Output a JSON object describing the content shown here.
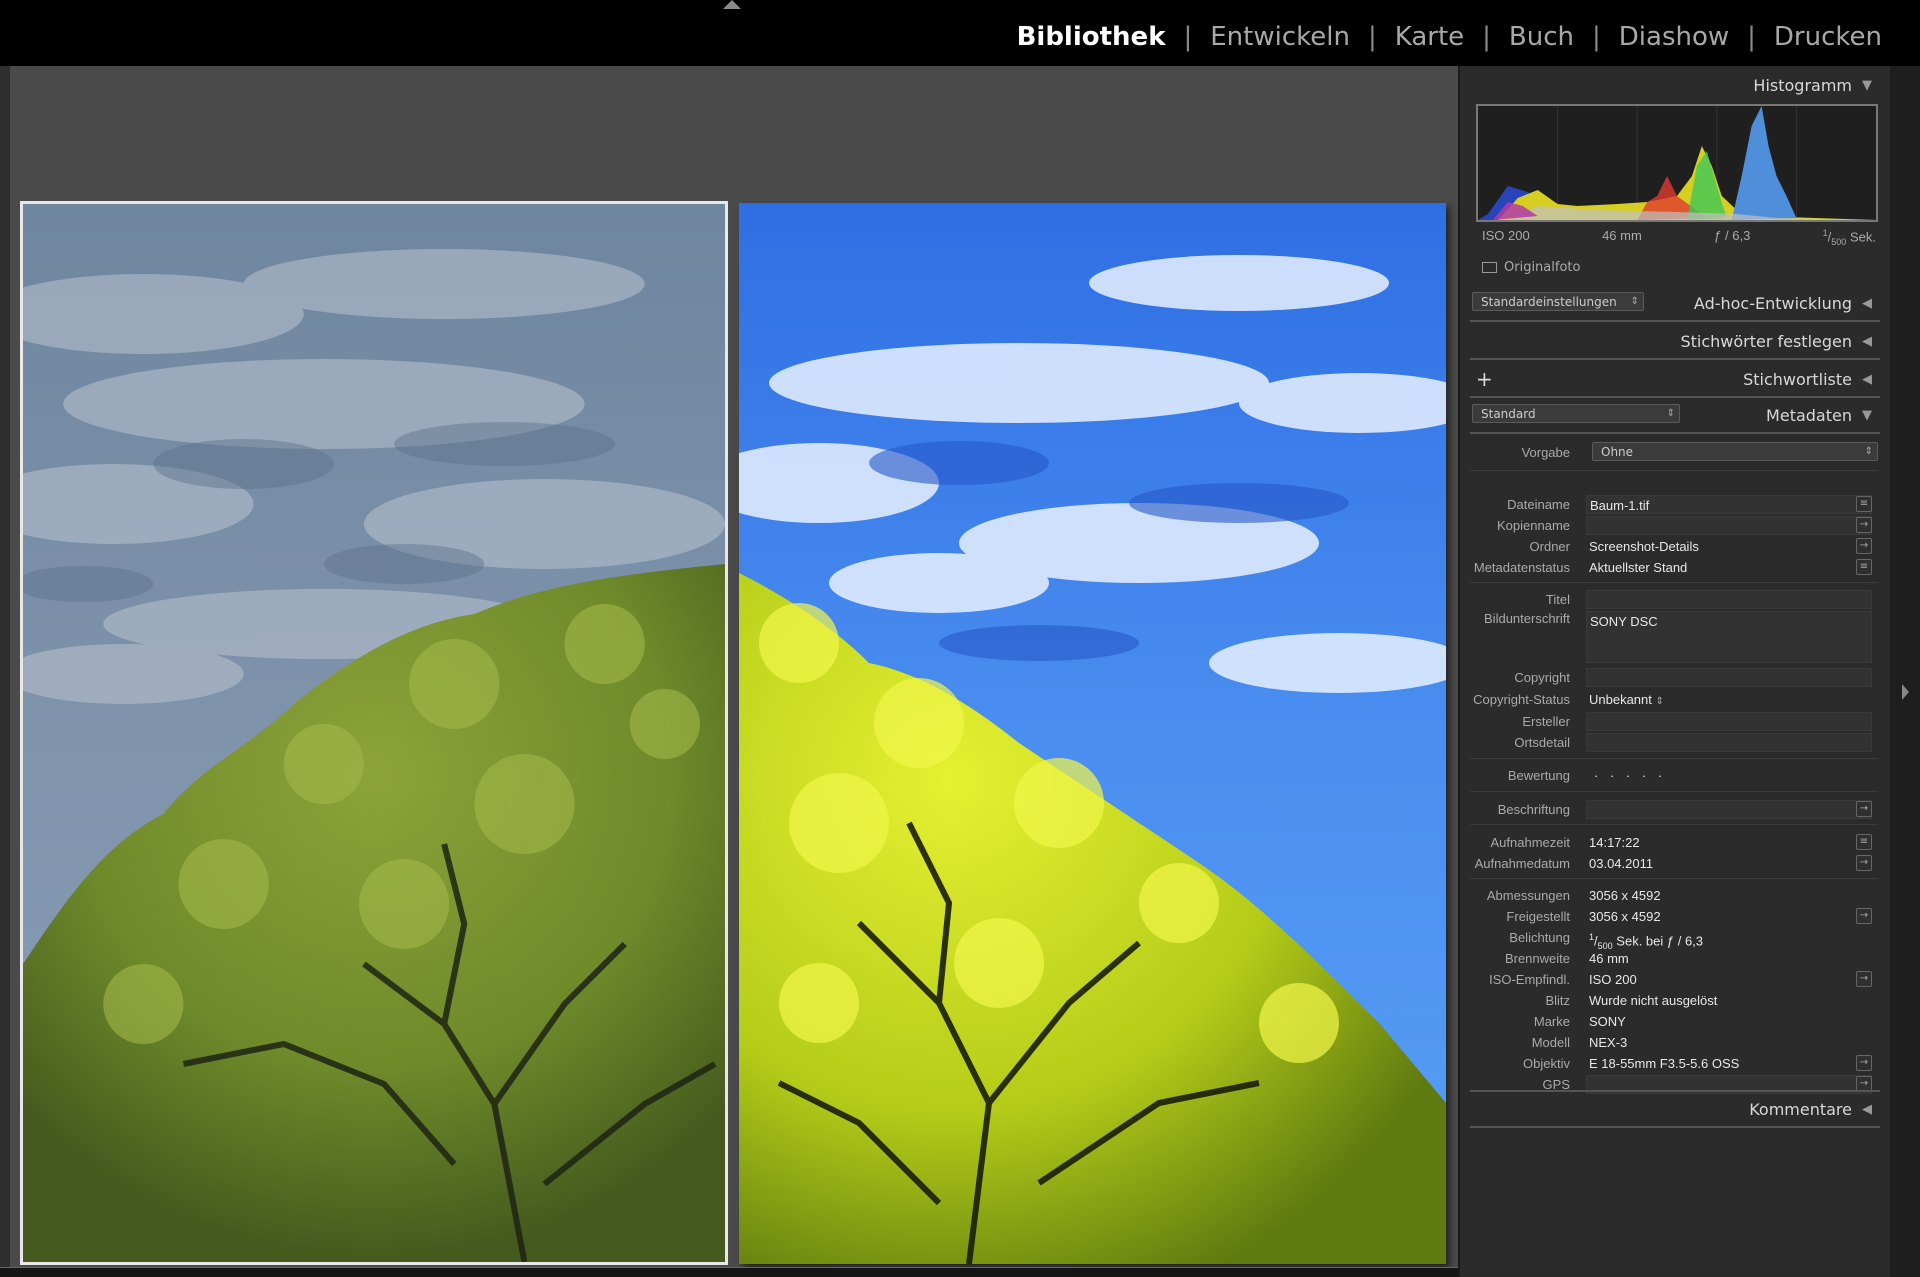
{
  "modules": [
    "Bibliothek",
    "Entwickeln",
    "Karte",
    "Buch",
    "Diashow",
    "Drucken"
  ],
  "active_module": "Bibliothek",
  "panel": {
    "histogram": {
      "title": "Histogramm",
      "iso": "ISO 200",
      "focal": "46 mm",
      "aperture": "ƒ / 6,3",
      "shutter_num": "1",
      "shutter_den": "500",
      "shutter_unit": "Sek.",
      "original_label": "Originalfoto"
    },
    "quick_develop": {
      "preset": "Standardeinstellungen",
      "title": "Ad-hoc-Entwicklung"
    },
    "keywording": {
      "title": "Stichwörter festlegen"
    },
    "keyword_list": {
      "add_icon": "+",
      "title": "Stichwortliste"
    },
    "metadata": {
      "view": "Standard",
      "title": "Metadaten",
      "preset_label": "Vorgabe",
      "preset_value": "Ohne",
      "fields": {
        "dateiname": {
          "label": "Dateiname",
          "value": "Baum-1.tif"
        },
        "kopienname": {
          "label": "Kopienname",
          "value": ""
        },
        "ordner": {
          "label": "Ordner",
          "value": "Screenshot-Details"
        },
        "status": {
          "label": "Metadatenstatus",
          "value": "Aktuellster Stand"
        },
        "titel": {
          "label": "Titel",
          "value": ""
        },
        "caption": {
          "label": "Bildunterschrift",
          "value": "SONY DSC"
        },
        "copyright": {
          "label": "Copyright",
          "value": ""
        },
        "copyright_status": {
          "label": "Copyright-Status",
          "value": "Unbekannt"
        },
        "ersteller": {
          "label": "Ersteller",
          "value": ""
        },
        "ortsdetail": {
          "label": "Ortsdetail",
          "value": ""
        },
        "bewertung": {
          "label": "Bewertung",
          "value": "·  ·  ·  ·  ·"
        },
        "beschriftung": {
          "label": "Beschriftung",
          "value": ""
        },
        "aufnahmezeit": {
          "label": "Aufnahmezeit",
          "value": "14:17:22"
        },
        "aufnahmedatum": {
          "label": "Aufnahmedatum",
          "value": "03.04.2011"
        },
        "abmessungen": {
          "label": "Abmessungen",
          "value": "3056 x 4592"
        },
        "freigestellt": {
          "label": "Freigestellt",
          "value": "3056 x 4592"
        },
        "belichtung": {
          "label": "Belichtung",
          "value_num": "1",
          "value_den": "500",
          "value_rest": "Sek. bei ƒ / 6,3"
        },
        "brennweite": {
          "label": "Brennweite",
          "value": "46 mm"
        },
        "iso": {
          "label": "ISO-Empfindl.",
          "value": "ISO 200"
        },
        "blitz": {
          "label": "Blitz",
          "value": "Wurde nicht ausgelöst"
        },
        "marke": {
          "label": "Marke",
          "value": "SONY"
        },
        "modell": {
          "label": "Modell",
          "value": "NEX-3"
        },
        "objektiv": {
          "label": "Objektiv",
          "value": "E 18-55mm F3.5-5.6 OSS"
        },
        "gps": {
          "label": "GPS",
          "value": ""
        }
      }
    },
    "comments": {
      "title": "Kommentare"
    }
  },
  "icons": {
    "collapse_open": "▼",
    "collapse_closed": "◀",
    "list_button": "≡",
    "arrow_button": "→",
    "updown": "⇕"
  }
}
